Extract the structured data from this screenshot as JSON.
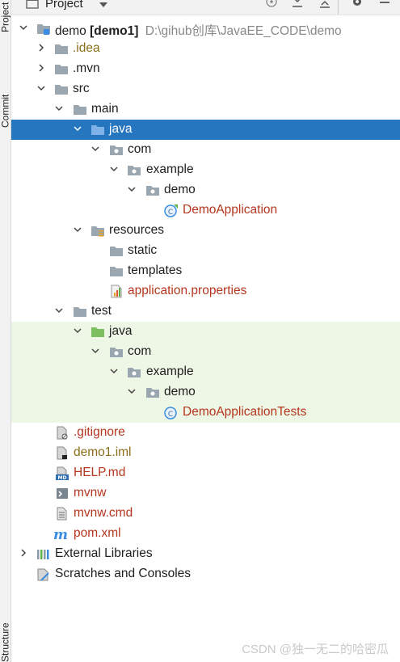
{
  "panel": {
    "title": "Project",
    "left_tabs": {
      "project": "Project",
      "commit": "Commit",
      "structure": "Structure"
    }
  },
  "tree": {
    "root": {
      "name": "demo",
      "module": "[demo1]",
      "path": "D:\\gihub创库\\JavaEE_CODE\\demo"
    },
    "idea": ".idea",
    "mvn": ".mvn",
    "src": "src",
    "main": "main",
    "main_java": "java",
    "main_com": "com",
    "main_example": "example",
    "main_demo": "demo",
    "demo_application": "DemoApplication",
    "resources": "resources",
    "static": "static",
    "templates": "templates",
    "application_properties": "application.properties",
    "test": "test",
    "test_java": "java",
    "test_com": "com",
    "test_example": "example",
    "test_demo": "demo",
    "demo_application_tests": "DemoApplicationTests",
    "gitignore": ".gitignore",
    "demo1_iml": "demo1.iml",
    "help_md": "HELP.md",
    "mvnw": "mvnw",
    "mvnw_cmd": "mvnw.cmd",
    "pom_xml": "pom.xml",
    "external_libraries": "External Libraries",
    "scratches": "Scratches and Consoles"
  },
  "watermark": "CSDN @独一无二的哈密瓜",
  "colors": {
    "selection": "#2675bf",
    "test_bg": "#eef6e6",
    "file_red": "#b5361e",
    "iml_olive": "#8a6e1a",
    "maven_blue": "#3a8de0"
  }
}
